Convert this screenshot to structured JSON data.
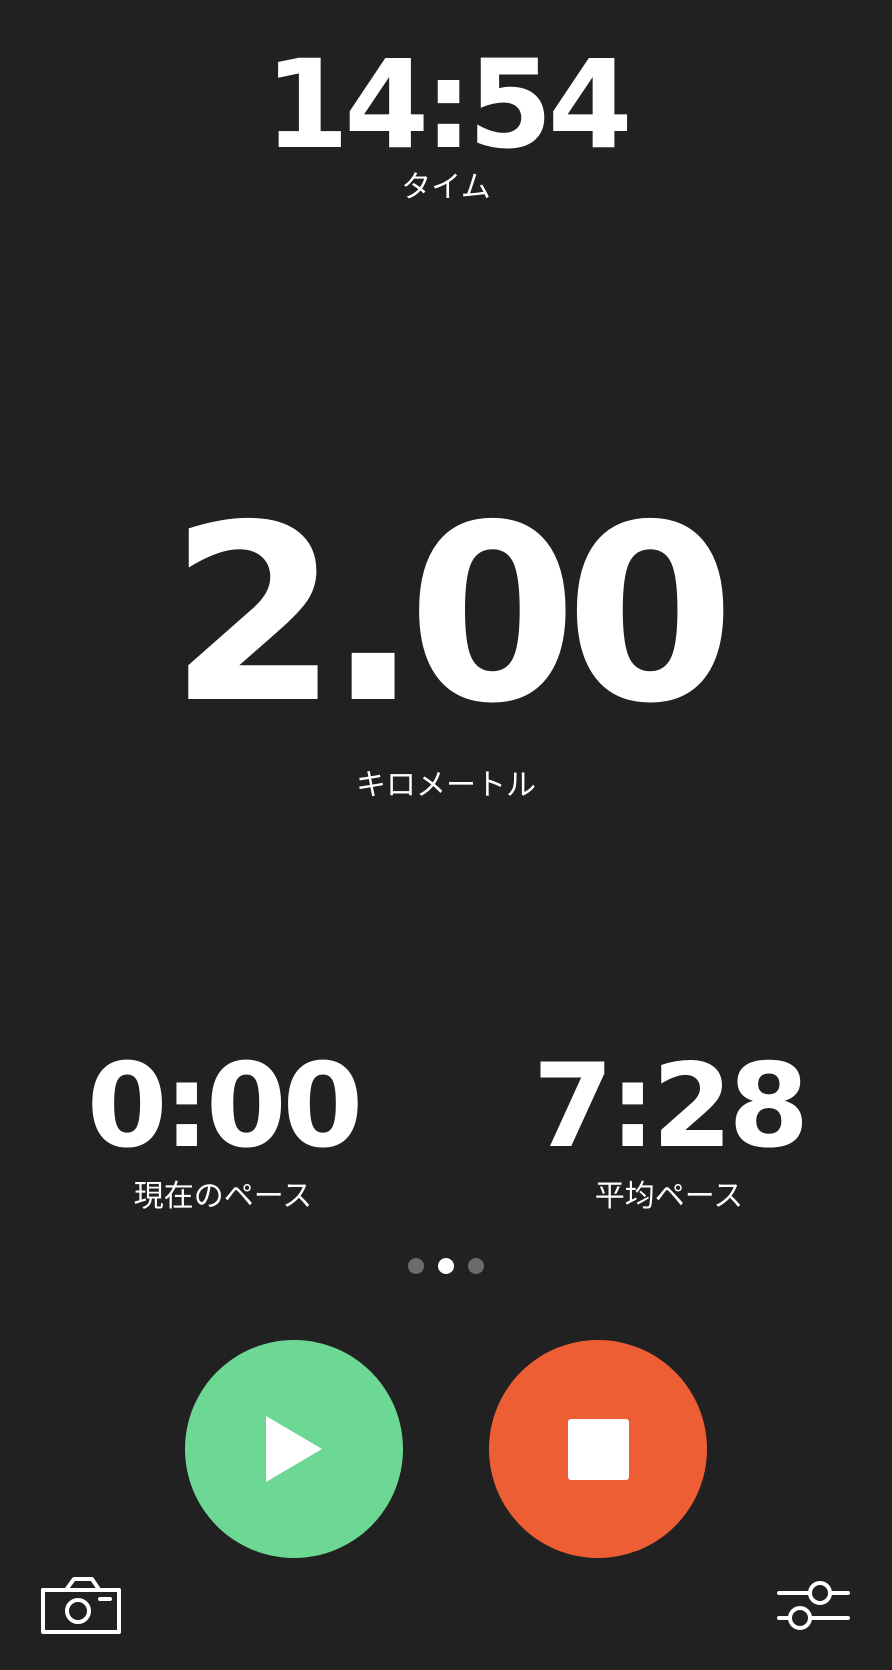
{
  "time": {
    "value": "14:54",
    "label": "タイム"
  },
  "distance": {
    "value": "2.00",
    "label": "キロメートル"
  },
  "current_pace": {
    "value": "0:00",
    "label": "現在のペース"
  },
  "average_pace": {
    "value": "7:28",
    "label": "平均ペース"
  },
  "pager": {
    "count": 3,
    "active_index": 1
  },
  "controls": {
    "play_icon": "play-icon",
    "stop_icon": "stop-icon",
    "camera_icon": "camera-icon",
    "settings_icon": "sliders-icon"
  },
  "colors": {
    "background": "#212121",
    "play": "#6cd893",
    "stop": "#ee5e34",
    "text": "#ffffff",
    "dot_inactive": "#6b6b6b"
  }
}
